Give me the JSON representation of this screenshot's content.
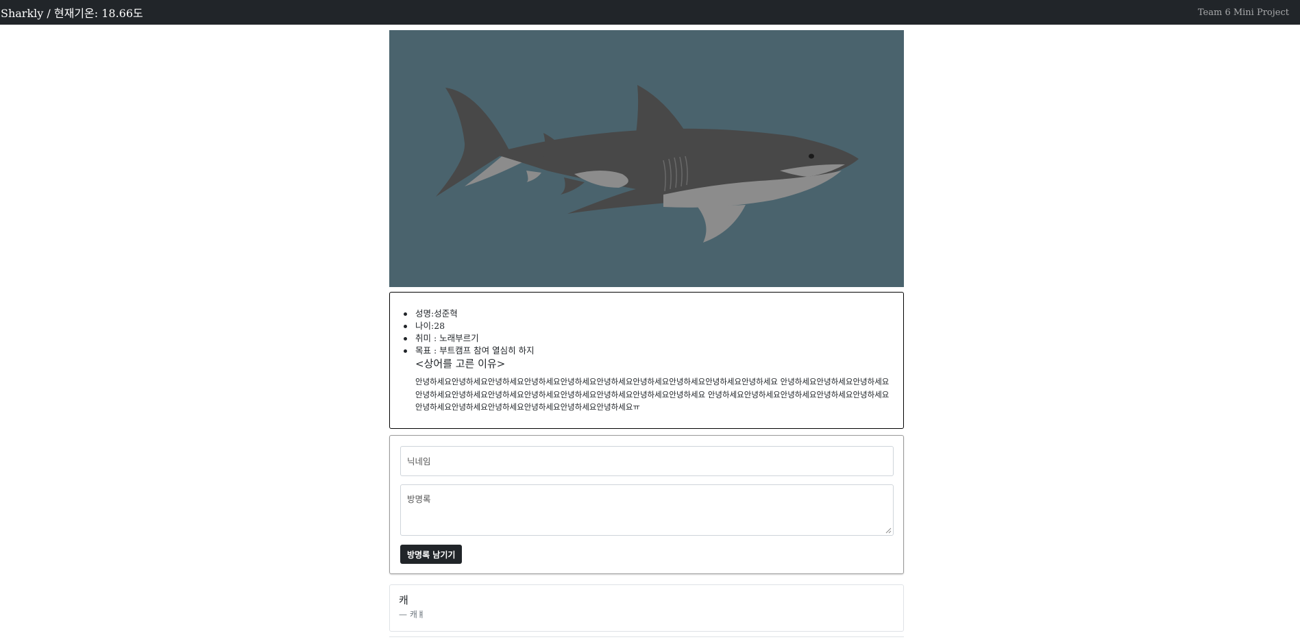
{
  "navbar": {
    "brand": "Sharkly / 현재기온: 18.66도",
    "project": "Team 6 Mini Project"
  },
  "hero": {
    "icon": "shark-illustration",
    "background": "#4a636d"
  },
  "profile": {
    "items": [
      "성명:성준혁",
      "나이:28",
      "취미 : 노래부르기",
      "목표 : 부트캠프 참여 열심히 하지"
    ],
    "reason_title": "<상어를 고른 이유>",
    "reason_body": "안녕하세요안녕하세요안녕하세요안녕하세요안녕하세요안녕하세요안녕하세요안녕하세요안녕하세요안녕하세요 안녕하세요안녕하세요안녕하세요안녕하세요안녕하세요안녕하세요안녕하세요안녕하세요안녕하세요안녕하세요안녕하세요 안녕하세요안녕하세요안녕하세요안녕하세요안녕하세요안녕하세요안녕하세요안녕하세요안녕하세요안녕하세요안녕하세요ㅠ"
  },
  "guestbook": {
    "nickname_placeholder": "닉네임",
    "message_placeholder": "방명록",
    "submit_label": "방명록 남기기"
  },
  "comments": [
    {
      "name": "캐",
      "text": "— 캐ㅒ"
    }
  ]
}
